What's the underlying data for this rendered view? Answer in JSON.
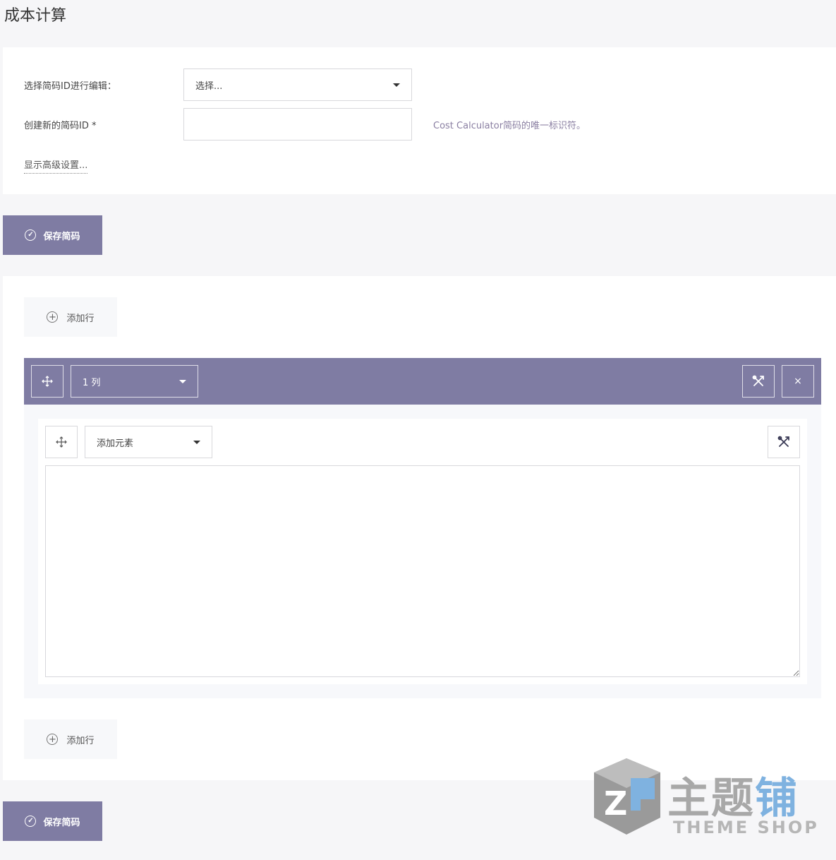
{
  "page": {
    "title": "成本计算"
  },
  "settings": {
    "select_label": "选择简码ID进行编辑：",
    "select_value": "选择...",
    "new_id_label": "创建新的简码ID *",
    "new_id_value": "",
    "new_id_hint": "Cost Calculator简码的唯一标识符。",
    "advanced_link": "显示高级设置..."
  },
  "actions": {
    "save_label": "保存简码"
  },
  "builder": {
    "add_row_label": "添加行",
    "row": {
      "columns_select": "1 列",
      "close_glyph": "×"
    },
    "column": {
      "add_element_select": "添加元素",
      "textarea_value": ""
    }
  },
  "watermark": {
    "cn": "主题",
    "cn_accent": "铺",
    "en": "THEME SHOP"
  },
  "icons": {
    "move": "move-icon",
    "tools": "tools-icon",
    "close": "close-icon",
    "check": "check-circle-icon",
    "plus": "plus-circle-icon",
    "caret": "caret-down-icon"
  },
  "colors": {
    "accent": "#7f7ca3",
    "hint": "#8a7fa2",
    "background": "#f6f6f8"
  }
}
